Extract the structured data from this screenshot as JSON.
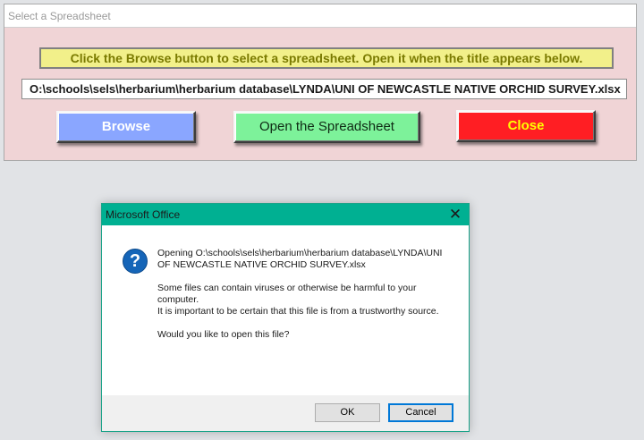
{
  "form": {
    "title": "Select a Spreadsheet",
    "instruction": "Click the Browse button to select a spreadsheet. Open it when the title appears below.",
    "file_path": "O:\\schools\\sels\\herbarium\\herbarium database\\LYNDA\\UNI OF NEWCASTLE NATIVE ORCHID SURVEY.xlsx",
    "buttons": {
      "browse": "Browse",
      "open": "Open the Spreadsheet",
      "close": "Close"
    },
    "colors": {
      "background": "#f0d4d6",
      "instruction_bg": "#f2f08a",
      "browse": "#8aa6ff",
      "open": "#7df29a",
      "close": "#ff1e23",
      "close_text": "#ffff00"
    }
  },
  "dialog": {
    "title": "Microsoft Office",
    "close_glyph": "✕",
    "icon": "question-icon",
    "icon_glyph": "?",
    "message_line1": "Opening O:\\schools\\sels\\herbarium\\herbarium database\\LYNDA\\UNI OF NEWCASTLE NATIVE ORCHID SURVEY.xlsx",
    "message_warning1": "Some files can contain viruses or otherwise be harmful to your computer.",
    "message_warning2": "It is important to be certain that this file is from a trustworthy source.",
    "message_question": "Would you like to open this file?",
    "ok_label": "OK",
    "cancel_label": "Cancel",
    "colors": {
      "titlebar": "#00b092",
      "default_button_border": "#0078d7"
    }
  }
}
